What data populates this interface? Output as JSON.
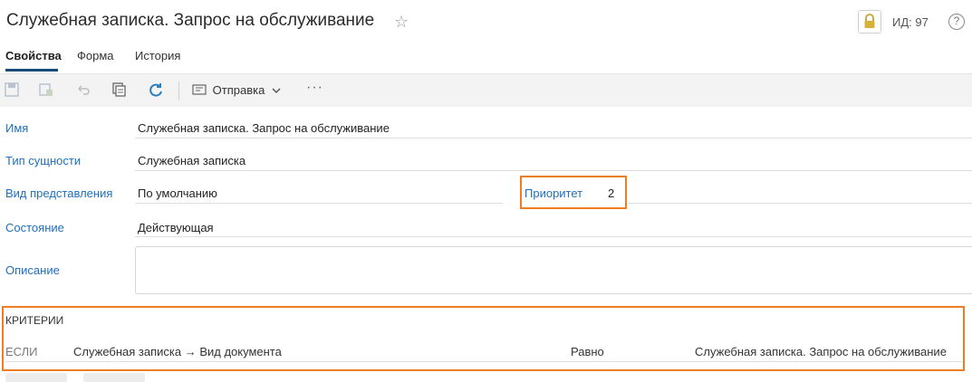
{
  "header": {
    "title": "Служебная записка. Запрос на обслуживание",
    "id_label": "ИД: 97",
    "help_symbol": "?"
  },
  "tabs": [
    {
      "label": "Свойства",
      "active": true
    },
    {
      "label": "Форма",
      "active": false
    },
    {
      "label": "История",
      "active": false
    }
  ],
  "toolbar": {
    "send_label": "Отправка",
    "icons": [
      "save-icon",
      "save-as-icon",
      "undo-icon",
      "copy-icon",
      "refresh-icon",
      "send-icon",
      "chevron-down-icon",
      "more-icon"
    ]
  },
  "fields": {
    "name": {
      "label": "Имя",
      "value": "Служебная записка. Запрос на обслуживание"
    },
    "entity_type": {
      "label": "Тип сущности",
      "value": "Служебная записка"
    },
    "view": {
      "label": "Вид представления",
      "value": "По умолчанию"
    },
    "priority": {
      "label": "Приоритет",
      "value": "2"
    },
    "state": {
      "label": "Состояние",
      "value": "Действующая"
    },
    "description": {
      "label": "Описание",
      "value": ""
    }
  },
  "criteria": {
    "header": "КРИТЕРИИ",
    "rows": [
      {
        "if": "ЕСЛИ",
        "field": "Служебная записка → Вид документа",
        "operator": "Равно",
        "value": "Служебная записка. Запрос на обслуживание"
      }
    ]
  },
  "colors": {
    "accent": "#1f6fbf",
    "highlight": "#ef7d22",
    "active_tab": "#1a4a7a",
    "toolbar_bg": "#f3f3f3"
  }
}
